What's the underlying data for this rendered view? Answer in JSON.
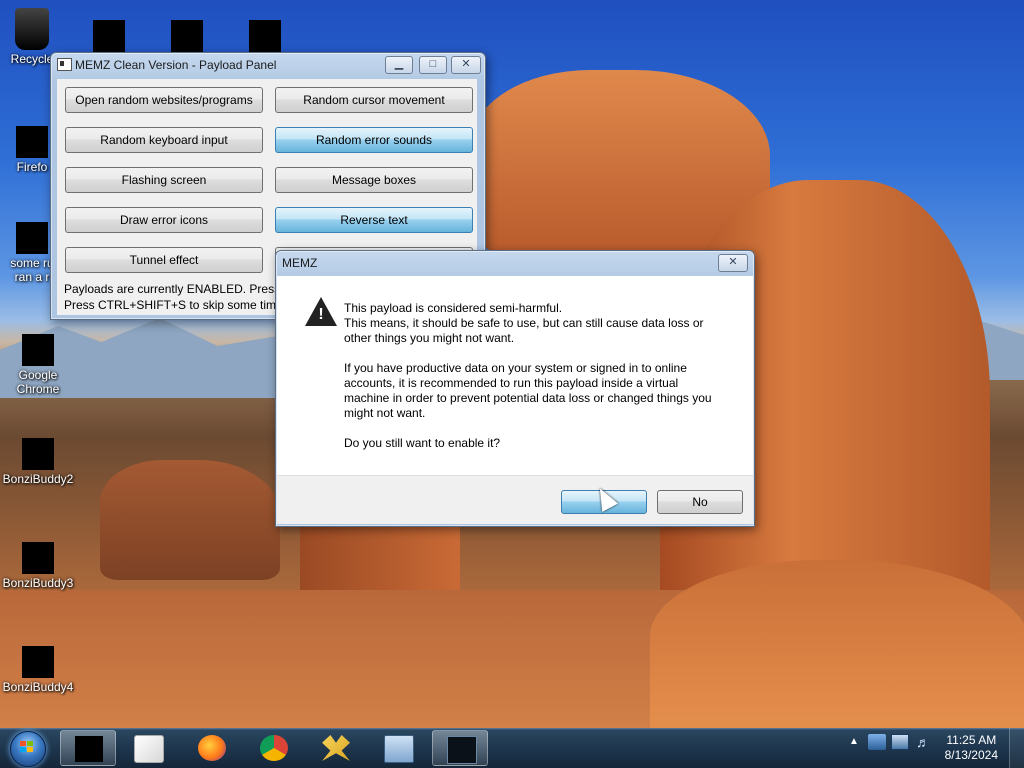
{
  "desktop": {
    "icons": [
      {
        "label": "Recycle"
      },
      {
        "label": "Firefo"
      },
      {
        "label": "some ru ran a r"
      },
      {
        "label": "Google Chrome"
      },
      {
        "label": "BonziBuddy2"
      },
      {
        "label": "BonziBuddy3"
      },
      {
        "label": "BonziBuddy4"
      }
    ]
  },
  "panel": {
    "title": "MEMZ Clean Version - Payload Panel",
    "buttons": [
      {
        "label": "Open random websites/programs",
        "enabled": false
      },
      {
        "label": "Random cursor movement",
        "enabled": false
      },
      {
        "label": "Random keyboard input",
        "enabled": false
      },
      {
        "label": "Random error sounds",
        "enabled": true
      },
      {
        "label": "Flashing screen",
        "enabled": false
      },
      {
        "label": "Message boxes",
        "enabled": false
      },
      {
        "label": "Draw error icons",
        "enabled": false
      },
      {
        "label": "Reverse text",
        "enabled": true
      },
      {
        "label": "Tunnel effect",
        "enabled": false
      }
    ],
    "status_line1": "Payloads are currently ENABLED. Press SHI",
    "status_line2": "Press CTRL+SHIFT+S to skip some time (ma"
  },
  "dialog": {
    "title": "MEMZ",
    "icon": "warning-icon",
    "lines": [
      "This payload is considered semi-harmful.",
      "This means, it should be safe to use, but can still cause data loss or",
      "other things you might not want.",
      "If you have productive data on your system or signed in to online",
      "accounts, it is recommended to run this payload inside a virtual",
      "machine in order to prevent potential data loss or changed things you",
      "might not want.",
      "Do you still want to enable it?"
    ],
    "yes_label": "",
    "no_label": "No"
  },
  "taskbar": {
    "apps": [
      "app-icon",
      "media-player-icon",
      "firefox-icon",
      "chrome-icon",
      "folder-network-icon",
      "keyboard-app-icon",
      "monitor-app-icon"
    ],
    "time": "11:25 AM",
    "date": "8/13/2024"
  },
  "colors": {
    "button_enabled": "#98d1ef",
    "taskbar": "#1e364e",
    "sky": "#2f6fd6"
  }
}
